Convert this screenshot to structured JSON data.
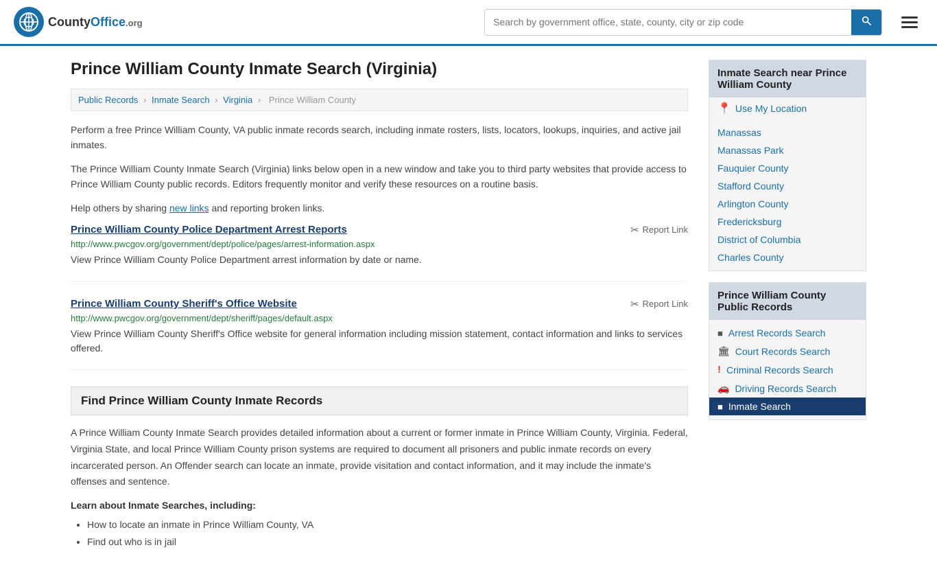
{
  "header": {
    "logo_text": "CountyOffice",
    "logo_org": ".org",
    "search_placeholder": "Search by government office, state, county, city or zip code"
  },
  "breadcrumb": {
    "items": [
      "Public Records",
      "Inmate Search",
      "Virginia",
      "Prince William County"
    ]
  },
  "page": {
    "title": "Prince William County Inmate Search (Virginia)",
    "description1": "Perform a free Prince William County, VA public inmate records search, including inmate rosters, lists, locators, lookups, inquiries, and active jail inmates.",
    "description2": "The Prince William County Inmate Search (Virginia) links below open in a new window and take you to third party websites that provide access to Prince William County public records. Editors frequently monitor and verify these resources on a routine basis.",
    "description3_pre": "Help others by sharing ",
    "description3_link": "new links",
    "description3_post": " and reporting broken links."
  },
  "links": [
    {
      "title": "Prince William County Police Department Arrest Reports",
      "url": "http://www.pwcgov.org/government/dept/police/pages/arrest-information.aspx",
      "description": "View Prince William County Police Department arrest information by date or name.",
      "report_label": "Report Link"
    },
    {
      "title": "Prince William County Sheriff's Office Website",
      "url": "http://www.pwcgov.org/government/dept/sheriff/pages/default.aspx",
      "description": "View Prince William County Sheriff's Office website for general information including mission statement, contact information and links to services offered.",
      "report_label": "Report Link"
    }
  ],
  "find_section": {
    "heading": "Find Prince William County Inmate Records",
    "body": "A Prince William County Inmate Search provides detailed information about a current or former inmate in Prince William County, Virginia. Federal, Virginia State, and local Prince William County prison systems are required to document all prisoners and public inmate records on every incarcerated person. An Offender search can locate an inmate, provide visitation and contact information, and it may include the inmate's offenses and sentence.",
    "learn_heading": "Learn about Inmate Searches, including:",
    "bullets": [
      "How to locate an inmate in Prince William County, VA",
      "Find out who is in jail"
    ]
  },
  "sidebar": {
    "nearby_title": "Inmate Search near Prince William County",
    "use_my_location": "Use My Location",
    "nearby_items": [
      "Manassas",
      "Manassas Park",
      "Fauquier County",
      "Stafford County",
      "Arlington County",
      "Fredericksburg",
      "District of Columbia",
      "Charles County"
    ],
    "public_records_title": "Prince William County Public Records",
    "public_records": [
      {
        "label": "Arrest Records Search",
        "icon": "■"
      },
      {
        "label": "Court Records Search",
        "icon": "🏛"
      },
      {
        "label": "Criminal Records Search",
        "icon": "!"
      },
      {
        "label": "Driving Records Search",
        "icon": "🚗"
      },
      {
        "label": "Inmate Search",
        "icon": "■",
        "active": true
      }
    ]
  }
}
